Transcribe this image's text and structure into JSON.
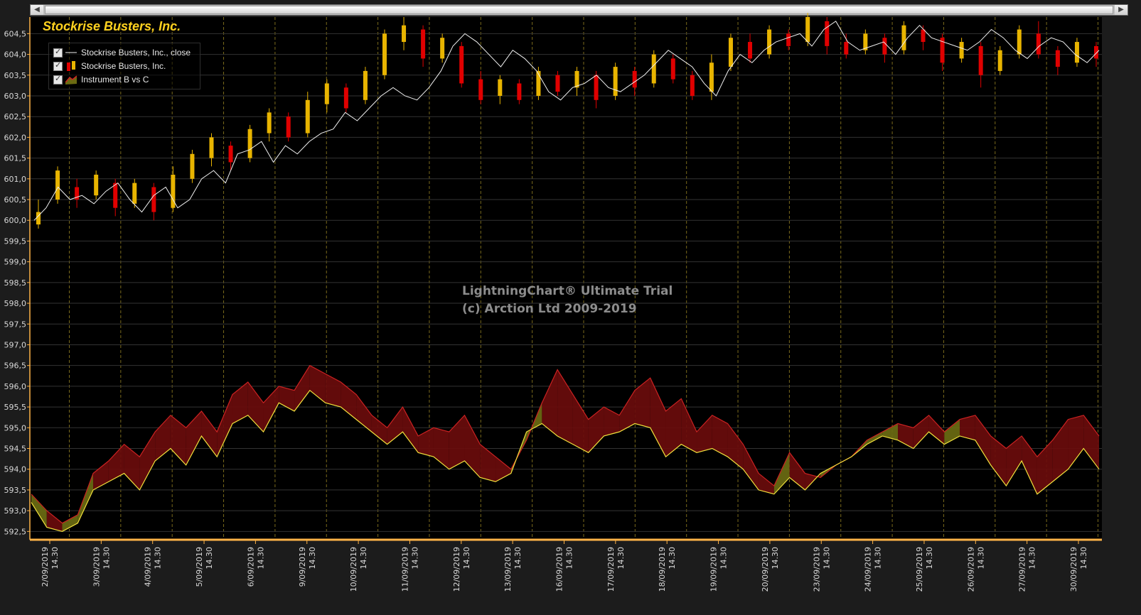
{
  "window": {
    "scroll_left_label": "◀",
    "scroll_right_label": "▶"
  },
  "colors": {
    "background": "#1c1c1c",
    "plot_background": "#000000",
    "title": "#ffd21f",
    "grid": "#333333",
    "axis_line": "#ffb347",
    "up_candle": "#e8b400",
    "down_candle": "#e00000",
    "close_line": "#f0f0f0",
    "band_red": "#6a0c0c",
    "band_olive": "#6b6b12",
    "line_yellow": "#f2e13c",
    "line_red": "#cc2222",
    "day_separator": "#7a6a1c"
  },
  "watermark": {
    "line1": "LightningChart® Ultimate Trial",
    "line2": "(c) Arction Ltd 2009-2019"
  },
  "chart_data": {
    "type": "line",
    "title": "Stockrise Busters, Inc.",
    "legend": {
      "placement": "top-left",
      "entries": [
        {
          "label": "Stockrise Busters, Inc., close",
          "symbol": "line-icon"
        },
        {
          "label": "Stockrise Busters, Inc.",
          "symbol": "candlestick-icon"
        },
        {
          "label": "Instrument B vs C",
          "symbol": "area-icon"
        }
      ]
    },
    "grid": true,
    "ylim": [
      592.3,
      604.9
    ],
    "y_ticks": [
      "592,5",
      "593,0",
      "593,5",
      "594,0",
      "594,5",
      "595,0",
      "595,5",
      "596,0",
      "596,5",
      "597,0",
      "597,5",
      "598,0",
      "598,5",
      "599,0",
      "599,5",
      "600,0",
      "600,5",
      "601,0",
      "601,5",
      "602,0",
      "602,5",
      "603,0",
      "603,5",
      "604,0",
      "604,5"
    ],
    "x_ticks": [
      {
        "date": "2/09/2019",
        "time": "14.30"
      },
      {
        "date": "3/09/2019",
        "time": "14.30"
      },
      {
        "date": "4/09/2019",
        "time": "14.30"
      },
      {
        "date": "5/09/2019",
        "time": "14.30"
      },
      {
        "date": "6/09/2019",
        "time": "14.30"
      },
      {
        "date": "9/09/2019",
        "time": "14.30"
      },
      {
        "date": "10/09/2019",
        "time": "14.30"
      },
      {
        "date": "11/09/2019",
        "time": "14.30"
      },
      {
        "date": "12/09/2019",
        "time": "14.30"
      },
      {
        "date": "13/09/2019",
        "time": "14.30"
      },
      {
        "date": "16/09/2019",
        "time": "14.30"
      },
      {
        "date": "17/09/2019",
        "time": "14.30"
      },
      {
        "date": "18/09/2019",
        "time": "14.30"
      },
      {
        "date": "19/09/2019",
        "time": "14.30"
      },
      {
        "date": "20/09/2019",
        "time": "14.30"
      },
      {
        "date": "23/09/2019",
        "time": "14.30"
      },
      {
        "date": "24/09/2019",
        "time": "14.30"
      },
      {
        "date": "25/09/2019",
        "time": "14.30"
      },
      {
        "date": "26/09/2019",
        "time": "14.30"
      },
      {
        "date": "27/09/2019",
        "time": "14.30"
      },
      {
        "date": "30/09/2019",
        "time": "14.30"
      }
    ],
    "close_series": [
      600.0,
      600.3,
      600.8,
      600.5,
      600.6,
      600.4,
      600.7,
      600.9,
      600.5,
      600.2,
      600.6,
      600.8,
      600.3,
      600.5,
      601.0,
      601.2,
      600.9,
      601.6,
      601.7,
      601.9,
      601.4,
      601.8,
      601.6,
      601.9,
      602.1,
      602.2,
      602.6,
      602.4,
      602.7,
      603.0,
      603.2,
      603.0,
      602.9,
      603.2,
      603.6,
      604.2,
      604.5,
      604.3,
      604.0,
      603.7,
      604.1,
      603.9,
      603.6,
      603.1,
      602.9,
      603.2,
      603.3,
      603.5,
      603.2,
      603.1,
      603.3,
      603.5,
      603.8,
      604.1,
      603.9,
      603.7,
      603.3,
      603.0,
      603.6,
      604.0,
      603.8,
      604.1,
      604.3,
      604.4,
      604.5,
      604.2,
      604.6,
      604.8,
      604.3,
      604.1,
      604.2,
      604.3,
      604.0,
      604.4,
      604.7,
      604.4,
      604.3,
      604.2,
      604.1,
      604.3,
      604.6,
      604.4,
      604.1,
      603.9,
      604.2,
      604.4,
      604.3,
      604.0,
      603.8,
      604.1
    ],
    "candles": [
      {
        "o": 599.9,
        "c": 600.2,
        "h": 600.5,
        "l": 599.8
      },
      {
        "o": 600.5,
        "c": 601.2,
        "h": 601.3,
        "l": 600.4
      },
      {
        "o": 600.8,
        "c": 600.5,
        "h": 601.0,
        "l": 600.3
      },
      {
        "o": 600.6,
        "c": 601.1,
        "h": 601.2,
        "l": 600.5
      },
      {
        "o": 600.9,
        "c": 600.3,
        "h": 601.0,
        "l": 600.1
      },
      {
        "o": 600.4,
        "c": 600.9,
        "h": 601.0,
        "l": 600.3
      },
      {
        "o": 600.8,
        "c": 600.2,
        "h": 600.9,
        "l": 600.0
      },
      {
        "o": 600.3,
        "c": 601.1,
        "h": 601.3,
        "l": 600.2
      },
      {
        "o": 601.0,
        "c": 601.6,
        "h": 601.7,
        "l": 600.9
      },
      {
        "o": 601.5,
        "c": 602.0,
        "h": 602.1,
        "l": 601.3
      },
      {
        "o": 601.8,
        "c": 601.4,
        "h": 601.9,
        "l": 601.2
      },
      {
        "o": 601.5,
        "c": 602.2,
        "h": 602.3,
        "l": 601.4
      },
      {
        "o": 602.1,
        "c": 602.6,
        "h": 602.7,
        "l": 601.9
      },
      {
        "o": 602.5,
        "c": 602.0,
        "h": 602.6,
        "l": 601.9
      },
      {
        "o": 602.1,
        "c": 602.9,
        "h": 603.1,
        "l": 602.0
      },
      {
        "o": 602.8,
        "c": 603.3,
        "h": 603.4,
        "l": 602.6
      },
      {
        "o": 603.2,
        "c": 602.7,
        "h": 603.3,
        "l": 602.6
      },
      {
        "o": 602.9,
        "c": 603.6,
        "h": 603.7,
        "l": 602.8
      },
      {
        "o": 603.5,
        "c": 604.5,
        "h": 604.6,
        "l": 603.4
      },
      {
        "o": 604.3,
        "c": 604.7,
        "h": 604.9,
        "l": 604.1
      },
      {
        "o": 604.6,
        "c": 603.9,
        "h": 604.7,
        "l": 603.7
      },
      {
        "o": 603.9,
        "c": 604.4,
        "h": 604.5,
        "l": 603.8
      },
      {
        "o": 604.2,
        "c": 603.3,
        "h": 604.3,
        "l": 603.2
      },
      {
        "o": 603.4,
        "c": 602.9,
        "h": 603.6,
        "l": 602.8
      },
      {
        "o": 603.0,
        "c": 603.4,
        "h": 603.5,
        "l": 602.8
      },
      {
        "o": 603.3,
        "c": 602.9,
        "h": 603.4,
        "l": 602.8
      },
      {
        "o": 603.0,
        "c": 603.6,
        "h": 603.7,
        "l": 602.9
      },
      {
        "o": 603.5,
        "c": 603.1,
        "h": 603.6,
        "l": 603.0
      },
      {
        "o": 603.2,
        "c": 603.6,
        "h": 603.7,
        "l": 603.0
      },
      {
        "o": 603.5,
        "c": 602.9,
        "h": 603.6,
        "l": 602.7
      },
      {
        "o": 603.0,
        "c": 603.7,
        "h": 603.8,
        "l": 602.9
      },
      {
        "o": 603.6,
        "c": 603.2,
        "h": 603.7,
        "l": 603.0
      },
      {
        "o": 603.3,
        "c": 604.0,
        "h": 604.1,
        "l": 603.2
      },
      {
        "o": 603.9,
        "c": 603.4,
        "h": 604.0,
        "l": 603.3
      },
      {
        "o": 603.5,
        "c": 603.0,
        "h": 603.6,
        "l": 602.9
      },
      {
        "o": 603.1,
        "c": 603.8,
        "h": 604.0,
        "l": 602.9
      },
      {
        "o": 603.7,
        "c": 604.4,
        "h": 604.5,
        "l": 603.6
      },
      {
        "o": 604.3,
        "c": 603.9,
        "h": 604.5,
        "l": 603.8
      },
      {
        "o": 604.0,
        "c": 604.6,
        "h": 604.7,
        "l": 603.9
      },
      {
        "o": 604.5,
        "c": 604.2,
        "h": 604.6,
        "l": 604.1
      },
      {
        "o": 604.3,
        "c": 604.9,
        "h": 605.0,
        "l": 604.2
      },
      {
        "o": 604.8,
        "c": 604.2,
        "h": 604.9,
        "l": 604.0
      },
      {
        "o": 604.3,
        "c": 604.0,
        "h": 604.5,
        "l": 603.9
      },
      {
        "o": 604.1,
        "c": 604.5,
        "h": 604.6,
        "l": 604.0
      },
      {
        "o": 604.4,
        "c": 604.0,
        "h": 604.5,
        "l": 603.8
      },
      {
        "o": 604.1,
        "c": 604.7,
        "h": 604.8,
        "l": 604.0
      },
      {
        "o": 604.6,
        "c": 604.3,
        "h": 604.7,
        "l": 604.1
      },
      {
        "o": 604.4,
        "c": 603.8,
        "h": 604.5,
        "l": 603.6
      },
      {
        "o": 603.9,
        "c": 604.3,
        "h": 604.4,
        "l": 603.8
      },
      {
        "o": 604.2,
        "c": 603.5,
        "h": 604.3,
        "l": 603.2
      },
      {
        "o": 603.6,
        "c": 604.1,
        "h": 604.2,
        "l": 603.5
      },
      {
        "o": 604.0,
        "c": 604.6,
        "h": 604.7,
        "l": 603.9
      },
      {
        "o": 604.5,
        "c": 604.0,
        "h": 604.8,
        "l": 603.9
      },
      {
        "o": 604.1,
        "c": 603.7,
        "h": 604.2,
        "l": 603.5
      },
      {
        "o": 603.8,
        "c": 604.3,
        "h": 604.4,
        "l": 603.7
      },
      {
        "o": 604.2,
        "c": 603.9,
        "h": 604.3,
        "l": 603.7
      }
    ],
    "band_upper": [
      593.4,
      593.0,
      592.7,
      592.9,
      593.9,
      594.2,
      594.6,
      594.3,
      594.9,
      595.3,
      595.0,
      595.4,
      594.9,
      595.8,
      596.1,
      595.6,
      596.0,
      595.9,
      596.5,
      596.3,
      596.1,
      595.8,
      595.3,
      595.0,
      595.5,
      594.8,
      595.0,
      594.9,
      595.3,
      594.6,
      594.3,
      594.0,
      594.7,
      595.6,
      596.4,
      595.8,
      595.2,
      595.5,
      595.3,
      595.9,
      596.2,
      595.4,
      595.7,
      594.9,
      595.3,
      595.1,
      594.6,
      593.9,
      593.6,
      594.4,
      593.9,
      593.8,
      594.1,
      594.3,
      594.7,
      594.9,
      595.1,
      595.0,
      595.3,
      594.9,
      595.2,
      595.3,
      594.8,
      594.5,
      594.8,
      594.3,
      594.7,
      595.2,
      595.3,
      594.8
    ],
    "band_lower": [
      593.2,
      592.6,
      592.5,
      592.7,
      593.5,
      593.7,
      593.9,
      593.5,
      594.2,
      594.5,
      594.1,
      594.8,
      594.3,
      595.1,
      595.3,
      594.9,
      595.6,
      595.4,
      595.9,
      595.6,
      595.5,
      595.2,
      594.9,
      594.6,
      594.9,
      594.4,
      594.3,
      594.0,
      594.2,
      593.8,
      593.7,
      593.9,
      594.9,
      595.1,
      594.8,
      594.6,
      594.4,
      594.8,
      594.9,
      595.1,
      595.0,
      594.3,
      594.6,
      594.4,
      594.5,
      594.3,
      594.0,
      593.5,
      593.4,
      593.8,
      593.5,
      593.9,
      594.1,
      594.3,
      594.6,
      594.8,
      594.7,
      594.5,
      594.9,
      594.6,
      594.8,
      594.7,
      594.1,
      593.6,
      594.2,
      593.4,
      593.7,
      594.0,
      594.5,
      594.0
    ]
  }
}
